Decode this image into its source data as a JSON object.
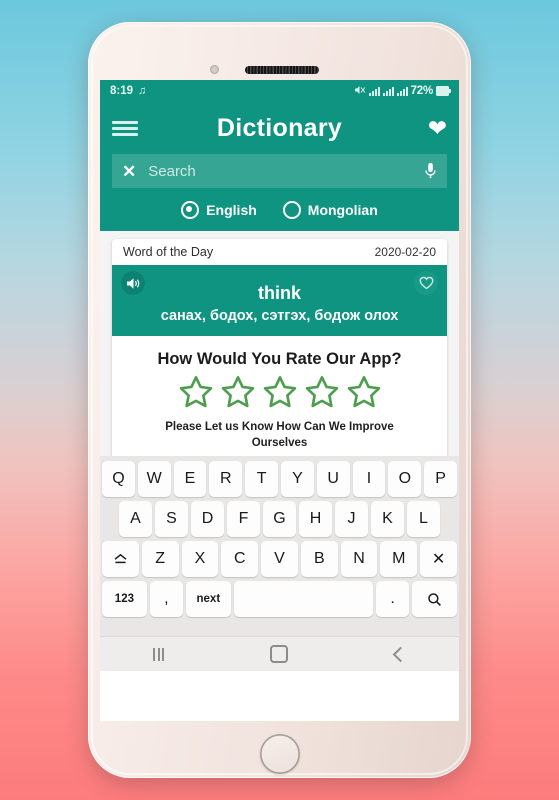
{
  "statusbar": {
    "time": "8:19",
    "music_icon": "music-note-icon",
    "mute_icon": "volume-mute-icon",
    "network_icon": "network-signal-icon",
    "signal_icon": "cellular-signal-icon",
    "battery_percent": "72%",
    "battery_icon": "battery-icon"
  },
  "appbar": {
    "menu_icon": "hamburger-menu-icon",
    "title": "Dictionary",
    "favorite_icon": "heart-filled-icon",
    "accent_color": "#0f9481"
  },
  "search": {
    "clear_icon": "close-x-icon",
    "value": "",
    "placeholder": "Search",
    "mic_icon": "microphone-icon"
  },
  "language": {
    "options": [
      {
        "label": "English",
        "selected": true
      },
      {
        "label": "Mongolian",
        "selected": false
      }
    ]
  },
  "word_of_the_day": {
    "header": "Word of the Day",
    "date": "2020-02-20",
    "speaker_icon": "speaker-volume-icon",
    "favorite_icon": "heart-outline-icon",
    "word": "think",
    "translation": "санах, бодох, сэтгэх, бодож олох"
  },
  "rating": {
    "title": "How Would You Rate Our App?",
    "star_icon": "star-outline-icon",
    "star_count": 5,
    "stars_filled": 0,
    "star_color": "#4f9e4f",
    "subtitle": "Please Let us Know How Can We Improve Ourselves"
  },
  "keyboard": {
    "row1": [
      "Q",
      "W",
      "E",
      "R",
      "T",
      "Y",
      "U",
      "I",
      "O",
      "P"
    ],
    "row2": [
      "A",
      "S",
      "D",
      "F",
      "G",
      "H",
      "J",
      "K",
      "L"
    ],
    "row3": [
      "Z",
      "X",
      "C",
      "V",
      "B",
      "N",
      "M"
    ],
    "shift_label": "⌂",
    "shift_icon": "shift-caps-icon",
    "backspace_icon": "backspace-x-icon",
    "backspace_label": "✕",
    "numbers_label": "123",
    "comma_label": ",",
    "next_label": "next",
    "space_label": "",
    "period_label": ".",
    "search_key_icon": "search-magnifier-icon"
  },
  "navbar": {
    "recents_icon": "recents-icon",
    "home_icon": "home-square-icon",
    "back_icon": "back-chevron-icon"
  },
  "device": {
    "camera_icon": "front-camera-icon",
    "speaker_icon": "earpiece-speaker-icon",
    "home_button_icon": "physical-home-button"
  }
}
